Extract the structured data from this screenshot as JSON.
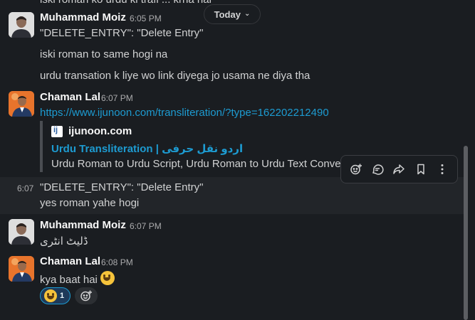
{
  "top_cut_text": "iski roman ko urdu ki trafi ... krna hai",
  "date_divider": {
    "label": "Today"
  },
  "messages": [
    {
      "author": "Muhammad Moiz",
      "time": "6:05 PM",
      "lines": [
        "\"DELETE_ENTRY\": \"Delete Entry\"",
        "iski roman to same hogi na",
        "urdu transation k liye wo link diyega jo usama ne diya tha"
      ]
    },
    {
      "author": "Chaman Lal",
      "time": "6:07 PM",
      "link": "https://www.ijunoon.com/transliteration/?type=162202212490",
      "unfurl": {
        "site": "ijunoon.com",
        "title": "Urdu Transliteration | اردو نقل حرفی",
        "description": "Urdu Roman to Urdu Script, Urdu Roman to Urdu Text Converter"
      }
    },
    {
      "continuation_time": "6:07",
      "lines": [
        "\"DELETE_ENTRY\": \"Delete Entry\"",
        "yes roman yahe hogi"
      ]
    },
    {
      "author": "Muhammad Moiz",
      "time": "6:07 PM",
      "lines": [
        "ڈلیٹ انٹری"
      ]
    },
    {
      "author": "Chaman Lal",
      "time": "6:08 PM",
      "lines": [
        "kya baat hai"
      ],
      "reactions": [
        {
          "emoji": "smile-emoji-icon",
          "count": "1"
        }
      ]
    }
  ],
  "toolbar": {
    "icons": [
      "add-reaction-icon",
      "reply-thread-icon",
      "forward-icon",
      "bookmark-icon",
      "more-actions-icon"
    ]
  },
  "colors": {
    "background": "#1a1d21",
    "link": "#1d9bd1",
    "hover_row": "#222529",
    "reaction_bg": "#1e3a5a"
  }
}
